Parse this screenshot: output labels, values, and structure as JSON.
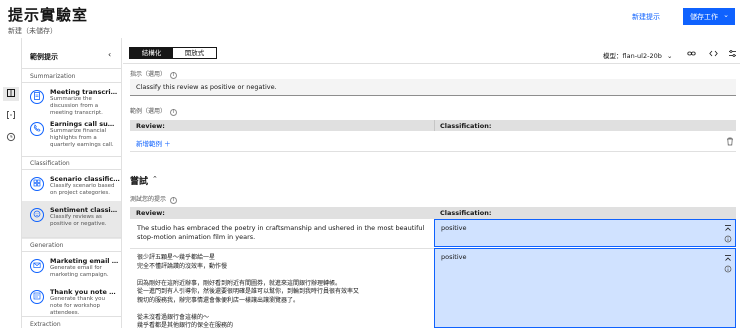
{
  "header": {
    "title": "提示實驗室",
    "subtitle": "新建（未儲存）",
    "new_prompt": "新建提示",
    "save_label": "儲存工作",
    "save_chevron": "⌄"
  },
  "rail": {
    "icons": [
      "book-icon",
      "brackets-icon",
      "history-icon"
    ]
  },
  "samples": {
    "title": "範例提示",
    "collapse": "‹",
    "sections": [
      {
        "label": "Summarization",
        "cards": [
          {
            "title": "Meeting transcript s...",
            "desc": "Summarize the discussion from a meeting transcript."
          },
          {
            "title": "Earnings call summary",
            "desc": "Summarize financial highlights from a quarterly earnings call."
          }
        ]
      },
      {
        "label": "Classification",
        "cards": [
          {
            "title": "Scenario classification",
            "desc": "Classify scenario based on project categories."
          },
          {
            "title": "Sentiment classifica...",
            "desc": "Classify reviews as positive or negative."
          }
        ]
      },
      {
        "label": "Generation",
        "cards": [
          {
            "title": "Marketing email gen...",
            "desc": "Generate email for marketing campaign."
          },
          {
            "title": "Thank you note gene...",
            "desc": "Generate thank you note for workshop attendees."
          }
        ]
      },
      {
        "label": "Extraction",
        "cards": []
      }
    ]
  },
  "toolbar": {
    "modes": [
      "結構化",
      "開放式"
    ],
    "model": "模型：flan-ul2-20b",
    "model_chevron": "⌄"
  },
  "instruction": {
    "label": "指示（選用）",
    "value": "Classify this review as positive or negative."
  },
  "examples": {
    "label": "範例（選用）",
    "col_input": "Review:",
    "col_output": "Classification:",
    "add_label": "新增範例 ＋"
  },
  "try": {
    "title": "嘗試",
    "chevron": "⌃",
    "label": "測試您的提示",
    "col_input": "Review:",
    "col_output": "Classification:",
    "rows": [
      {
        "input": "The studio has embraced the poetry in craftsmanship and ushered in the most beautiful stop-motion animation film in years.",
        "output": "positive"
      },
      {
        "input": "很少評五顆星～幾乎都給一星\n完全不懂評論讚的沒效率，動作慢\n\n因為剛好在這附近辦事，剛好看到附近有間圖券，就進來這間銀行辦理轉帳。\n從一進門到有人引導你，然後還要很明確是誰可以幫你，到輪到我時行員很有效率又\n親切的服務我，辦完事情還會像便利店一樣讓出讓瀏覽器了。\n\n從未沒看過銀行會這樣的～\n幾乎看都是其他銀行的保全在服務的",
        "output": "positive"
      }
    ]
  }
}
